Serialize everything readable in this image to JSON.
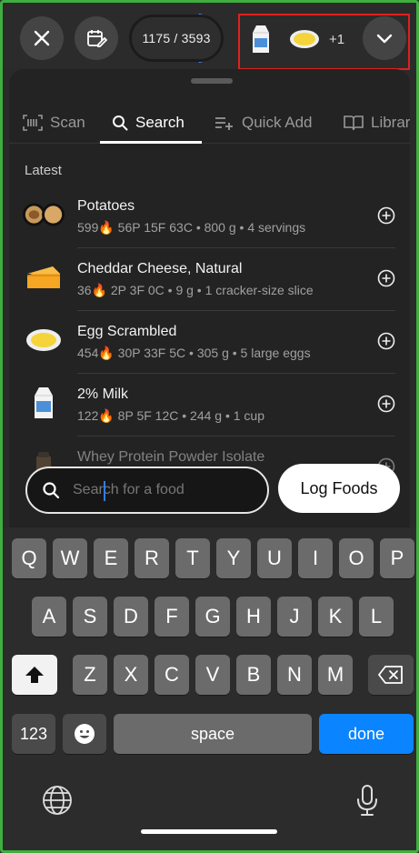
{
  "header": {
    "calories": "1175 / 3593",
    "calorie_progress_fraction": 0.33,
    "selected_extra_count": "+1",
    "selected_icons": [
      "milk-carton-icon",
      "scrambled-egg-icon"
    ]
  },
  "tabs": [
    {
      "label": "Scan",
      "icon": "barcode-icon"
    },
    {
      "label": "Search",
      "icon": "search-icon"
    },
    {
      "label": "Quick Add",
      "icon": "quick-add-icon"
    },
    {
      "label": "Library",
      "icon": "book-icon"
    }
  ],
  "section_title": "Latest",
  "foods": [
    {
      "name": "Potatoes",
      "meta": "599🔥 56P 15F 63C • 800 g • 4 servings",
      "icon": "potatoes-icon"
    },
    {
      "name": "Cheddar Cheese, Natural",
      "meta": "36🔥 2P 3F 0C • 9 g • 1 cracker-size slice",
      "icon": "cheese-icon"
    },
    {
      "name": "Egg Scrambled",
      "meta": "454🔥 30P 33F 5C • 305 g • 5 large eggs",
      "icon": "scrambled-egg-icon"
    },
    {
      "name": "2% Milk",
      "meta": "122🔥 8P 5F 12C • 244 g • 1 cup",
      "icon": "milk-carton-icon"
    },
    {
      "name": "Whey Protein Powder Isolate",
      "meta": "",
      "icon": "protein-powder-icon"
    }
  ],
  "search": {
    "placeholder": "Search for a food",
    "value": ""
  },
  "log_button": "Log Foods",
  "keyboard": {
    "row1": [
      "Q",
      "W",
      "E",
      "R",
      "T",
      "Y",
      "U",
      "I",
      "O",
      "P"
    ],
    "row2": [
      "A",
      "S",
      "D",
      "F",
      "G",
      "H",
      "J",
      "K",
      "L"
    ],
    "row3": [
      "Z",
      "X",
      "C",
      "V",
      "B",
      "N",
      "M"
    ],
    "numbers": "123",
    "space": "space",
    "done": "done"
  },
  "colors": {
    "accent_blue": "#0a84ff",
    "highlight_red": "#e02020",
    "frame_green": "#3fae3f"
  }
}
